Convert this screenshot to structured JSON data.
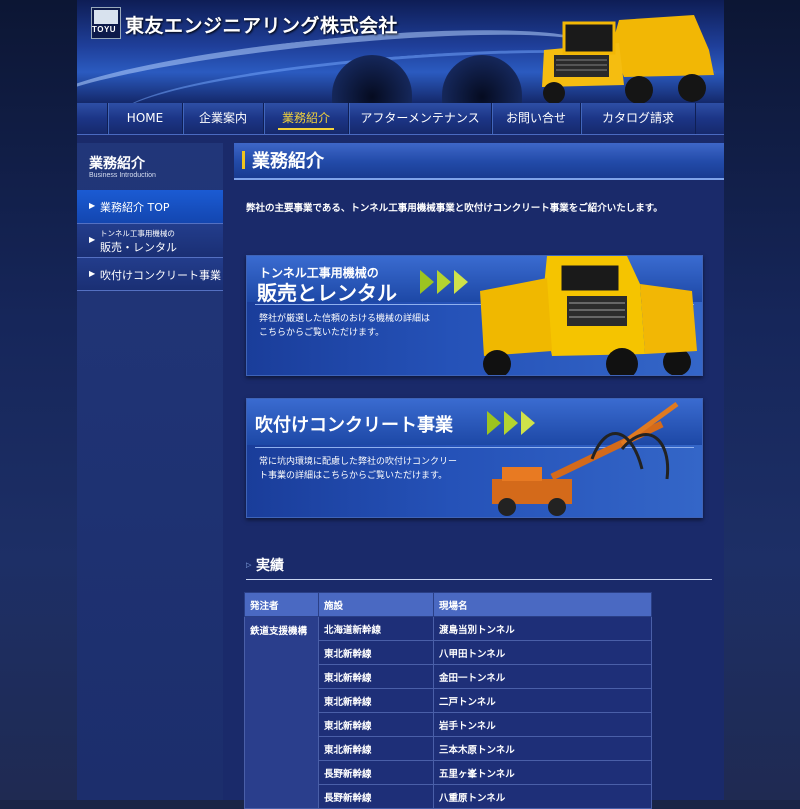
{
  "header": {
    "logo_text": "TOYU",
    "company_name": "東友エンジニアリング株式会社"
  },
  "nav": {
    "items": [
      {
        "label": "HOME"
      },
      {
        "label": "企業案内"
      },
      {
        "label": "業務紹介"
      },
      {
        "label": "アフターメンテナンス"
      },
      {
        "label": "お問い合せ"
      },
      {
        "label": "カタログ請求"
      }
    ],
    "active_index": 2
  },
  "sidebar": {
    "title": "業務紹介",
    "subtitle": "Business Introduction",
    "items": [
      {
        "label": "業務紹介 TOP"
      },
      {
        "small": "トンネル工事用機械の",
        "label": "販売・レンタル"
      },
      {
        "label": "吹付けコンクリート事業"
      }
    ]
  },
  "main": {
    "title": "業務紹介",
    "intro": "弊社の主要事業である、トンネル工事用機械事業と吹付けコンクリート事業をご紹介いたします。",
    "banner1": {
      "small_title": "トンネル工事用機械の",
      "big_title": "販売とレンタル",
      "desc_line1": "弊社が厳選した信頼のおける機械の詳細は",
      "desc_line2": "こちらからご覧いただけます。"
    },
    "banner2": {
      "title": "吹付けコンクリート事業",
      "desc_line1": "常に坑内環境に配慮した弊社の吹付けコンクリー",
      "desc_line2": "ト事業の詳細はこちらからご覧いただけます。"
    },
    "results": {
      "heading": "実績",
      "columns": [
        "発注者",
        "施設",
        "現場名"
      ],
      "client": "鉄道支援機構",
      "rows": [
        {
          "facility": "北海道新幹線",
          "site": "渡島当別トンネル"
        },
        {
          "facility": "東北新幹線",
          "site": "八甲田トンネル"
        },
        {
          "facility": "東北新幹線",
          "site": "金田一トンネル"
        },
        {
          "facility": "東北新幹線",
          "site": "二戸トンネル"
        },
        {
          "facility": "東北新幹線",
          "site": "岩手トンネル"
        },
        {
          "facility": "東北新幹線",
          "site": "三本木原トンネル"
        },
        {
          "facility": "長野新幹線",
          "site": "五里ヶ峯トンネル"
        },
        {
          "facility": "長野新幹線",
          "site": "八重原トンネル"
        }
      ]
    }
  },
  "colors": {
    "accent": "#f3d23a",
    "chevron": "#9cc420",
    "truck": "#f2b705"
  }
}
